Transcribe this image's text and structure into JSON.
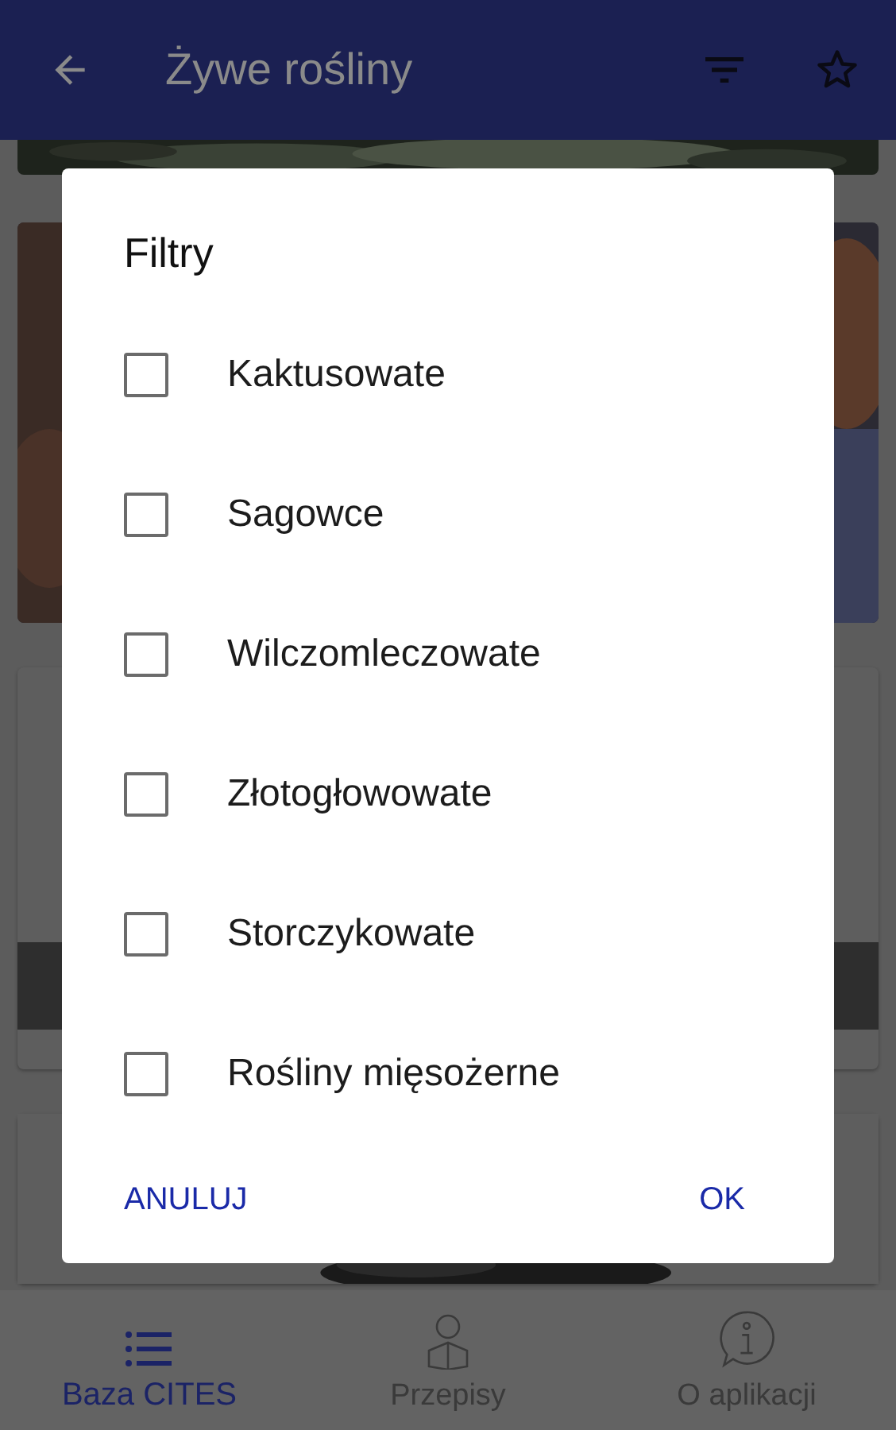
{
  "app_bar": {
    "title": "Żywe rośliny"
  },
  "filter_dialog": {
    "title": "Filtry",
    "options": [
      {
        "label": "Kaktusowate",
        "checked": false
      },
      {
        "label": "Sagowce",
        "checked": false
      },
      {
        "label": "Wilczomleczowate",
        "checked": false
      },
      {
        "label": "Złotogłowowate",
        "checked": false
      },
      {
        "label": "Storczykowate",
        "checked": false
      },
      {
        "label": "Rośliny mięsożerne",
        "checked": false
      }
    ],
    "buttons": [
      {
        "label": "ANULUJ",
        "kind": "cancel"
      },
      {
        "label": "OK",
        "kind": "confirm"
      }
    ]
  },
  "bottom_nav": [
    {
      "label": "Baza CITES",
      "selected": true,
      "kind": "list"
    },
    {
      "label": "Przepisy",
      "selected": false,
      "kind": "reader"
    },
    {
      "label": "O aplikacji",
      "selected": false,
      "kind": "info"
    }
  ]
}
